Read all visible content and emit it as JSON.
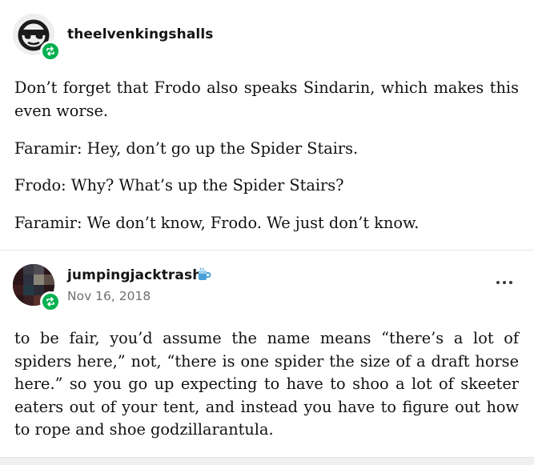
{
  "posts": [
    {
      "username": "theelvenkingshalls",
      "avatar_icon": "sunglasses-avatar-icon",
      "badge_icon": "reblog-icon",
      "paragraphs": [
        "Don’t forget that Frodo also speaks Sindarin, which makes this even worse.",
        "Faramir: Hey, don’t go up the Spider Stairs.",
        "Frodo: Why? What’s up the Spider Stairs?",
        "Faramir: We don’t know, Frodo. We just don’t know."
      ]
    },
    {
      "username": "jumpingjacktrash",
      "date": "Nov 16, 2018",
      "avatar_icon": "pixel-avatar-icon",
      "badge_icon": "reblog-icon",
      "user_badge_icon": "coffee-cup-badge-icon",
      "more_icon": "more-options-icon",
      "paragraphs": [
        "to be fair, you’d assume the name means “there’s a lot of spiders here,” not, “there is one spider the size of a draft horse here.” so you go up expecting to have to shoo a lot of skeeter eaters out of your tent, and instead you have to figure out how to rope and shoe godzillarantula."
      ]
    }
  ],
  "colors": {
    "reblog_green": "#00b04f",
    "divider": "#e6e6e6",
    "date_gray": "#6f6f6f"
  }
}
